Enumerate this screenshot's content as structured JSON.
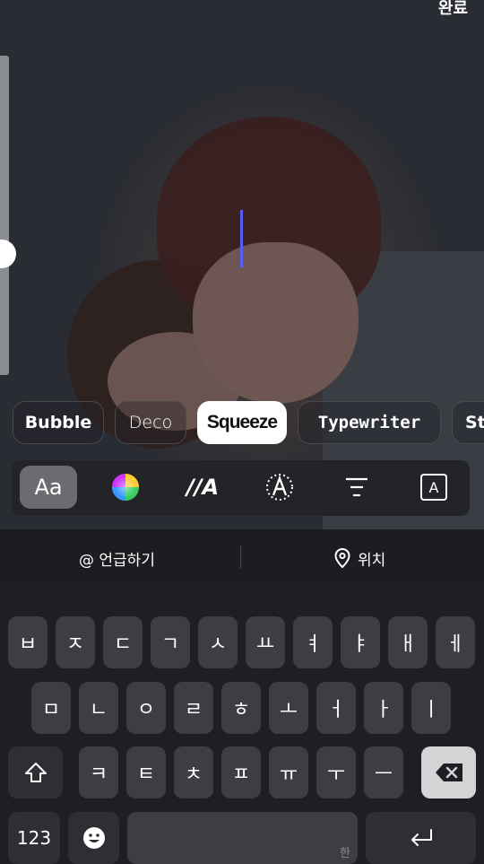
{
  "header": {
    "done_label": "완료"
  },
  "text_styles": [
    {
      "label": "Bubble"
    },
    {
      "label": "Deco"
    },
    {
      "label": "Squeeze",
      "selected": true
    },
    {
      "label": "Typewriter"
    },
    {
      "label": "St"
    }
  ],
  "toolbar": {
    "font_label": "Aa",
    "color_icon": "color-wheel-icon",
    "animation_label": "//A",
    "effect_icon": "text-effect-icon",
    "align_icon": "align-center-icon",
    "background_label": "A"
  },
  "suggestions": {
    "mention_label": "@ 언급하기",
    "location_label": "위치"
  },
  "keyboard": {
    "row1": [
      "ㅂ",
      "ㅈ",
      "ㄷ",
      "ㄱ",
      "ㅅ",
      "ㅛ",
      "ㅕ",
      "ㅑ",
      "ㅐ",
      "ㅔ"
    ],
    "row2": [
      "ㅁ",
      "ㄴ",
      "ㅇ",
      "ㄹ",
      "ㅎ",
      "ㅗ",
      "ㅓ",
      "ㅏ",
      "ㅣ"
    ],
    "row3": [
      "ㅋ",
      "ㅌ",
      "ㅊ",
      "ㅍ",
      "ㅠ",
      "ㅜ",
      "ㅡ"
    ],
    "numbers_label": "123",
    "space_hint": "한",
    "colors": {
      "cursor": "#5b5cf6",
      "key": "#3d3e42",
      "delete_key": "#d4d4d6"
    }
  }
}
